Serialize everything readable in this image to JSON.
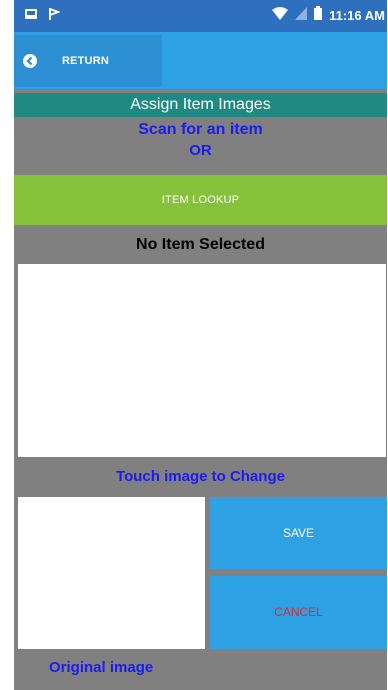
{
  "status_bar": {
    "time": "11:16 AM",
    "icons": [
      "image-icon",
      "flag-icon",
      "wifi-icon",
      "signal-icon",
      "battery-icon"
    ]
  },
  "header": {
    "return_label": "RETURN",
    "return_icon": "back-circle-icon"
  },
  "title": "Assign Item Images",
  "scan": {
    "line1": "Scan for an item",
    "line2": "OR"
  },
  "item_lookup_label": "ITEM LOOKUP",
  "selected_item_text": "No Item Selected",
  "touch_hint": "Touch image to Change",
  "actions": {
    "save_label": "SAVE",
    "cancel_label": "CANCEL"
  },
  "original_image_label": "Original image",
  "colors": {
    "status_bar": "#2e6fbe",
    "app_bar": "#2ea0e4",
    "title_bar": "#1f8a82",
    "lookup_green": "#86c13c",
    "label_blue": "#1c1cf0",
    "cancel_red": "#e0282a",
    "panel_gray": "#808080"
  }
}
